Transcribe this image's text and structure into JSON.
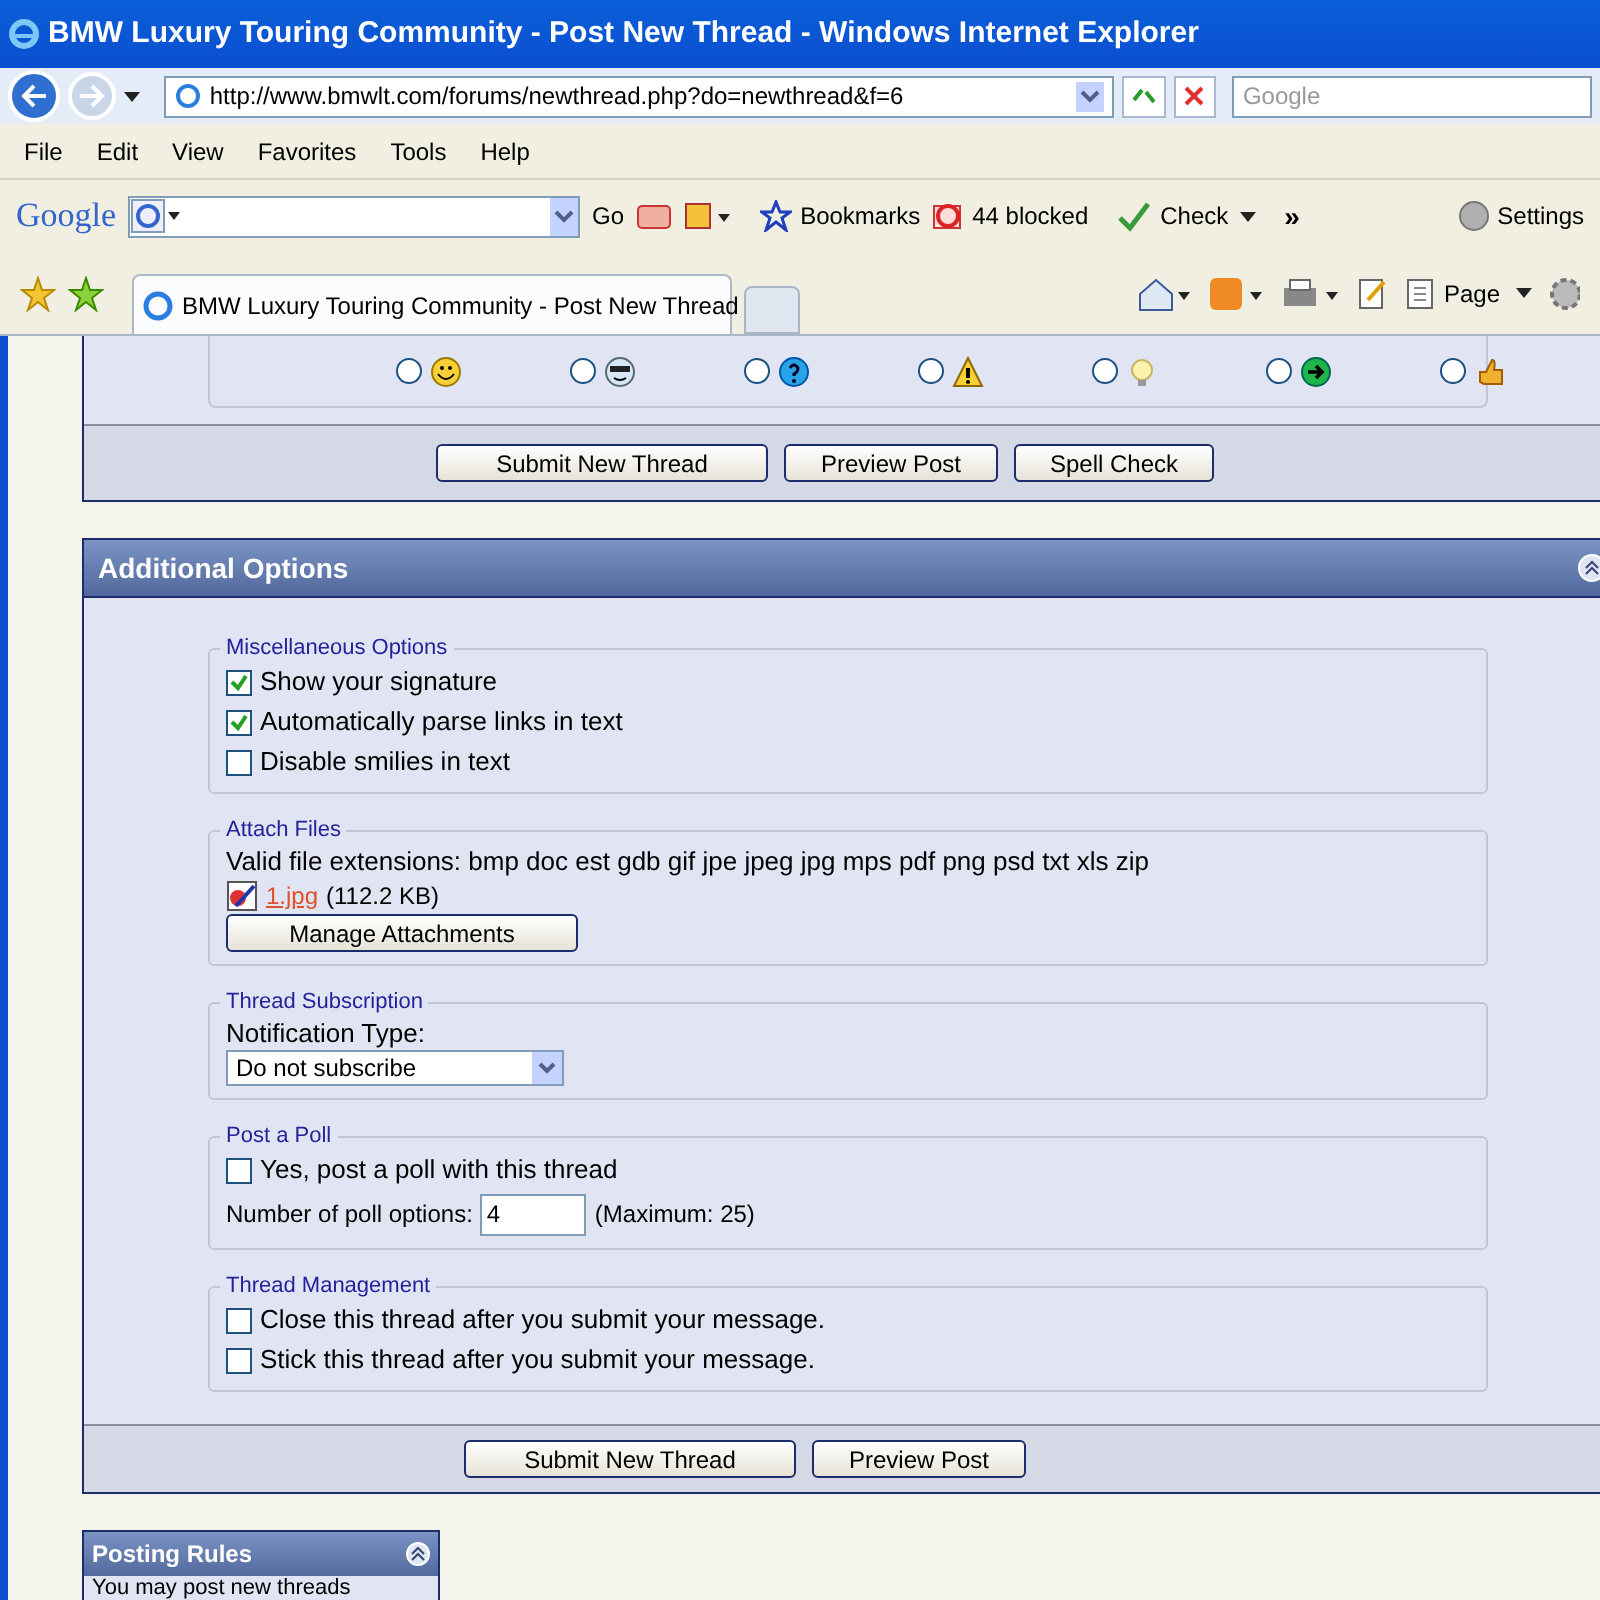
{
  "window": {
    "title": "BMW Luxury Touring Community - Post New Thread - Windows Internet Explorer"
  },
  "address_bar": {
    "url": "http://www.bmwlt.com/forums/newthread.php?do=newthread&f=6",
    "search_placeholder": "Google"
  },
  "menu": [
    "File",
    "Edit",
    "View",
    "Favorites",
    "Tools",
    "Help"
  ],
  "google_toolbar": {
    "logo": "Google",
    "go": "Go",
    "bookmarks": "Bookmarks",
    "blocked": "44 blocked",
    "check": "Check",
    "more": "»",
    "settings": "Settings"
  },
  "tabs": [
    {
      "label": "BMW Luxury Touring Community - Post New Thread",
      "selected": true
    }
  ],
  "command_bar": {
    "page": "Page"
  },
  "post_icons": [
    {
      "kind": "smile",
      "selected": false
    },
    {
      "kind": "cool",
      "selected": false
    },
    {
      "kind": "question",
      "selected": false
    },
    {
      "kind": "warning",
      "selected": false
    },
    {
      "kind": "idea",
      "selected": false
    },
    {
      "kind": "arrow",
      "selected": false
    },
    {
      "kind": "thumbs",
      "selected": false
    }
  ],
  "top_buttons": [
    "Submit New Thread",
    "Preview Post",
    "Spell Check"
  ],
  "additional_options": {
    "title": "Additional Options",
    "sections": [
      {
        "legend": "Miscellaneous Options",
        "items": [
          {
            "kind": "checkbox",
            "label": "Show your signature",
            "checked": true
          },
          {
            "kind": "checkbox",
            "label": "Automatically parse links in text",
            "checked": true
          },
          {
            "kind": "checkbox",
            "label": "Disable smilies in text",
            "checked": false
          }
        ]
      },
      {
        "legend": "Attach Files",
        "items": [
          {
            "kind": "text",
            "text": "Valid file extensions: bmp doc est gdb gif jpe jpeg jpg mps pdf png psd txt xls zip"
          },
          {
            "kind": "attachment",
            "file": "1.jpg",
            "size": "(112.2 KB)"
          },
          {
            "kind": "button",
            "label": "Manage Attachments"
          }
        ]
      },
      {
        "legend": "Thread Subscription",
        "items": [
          {
            "kind": "text",
            "text": "Notification Type:"
          },
          {
            "kind": "select",
            "value": "Do not subscribe"
          }
        ]
      },
      {
        "legend": "Post a Poll",
        "items": [
          {
            "kind": "checkbox",
            "label": "Yes, post a poll with this thread",
            "checked": false
          },
          {
            "kind": "number",
            "label": "Number of poll options:",
            "value": "4",
            "note": "(Maximum: 25)"
          }
        ]
      },
      {
        "legend": "Thread Management",
        "items": [
          {
            "kind": "checkbox",
            "label": "Close this thread after you submit your message.",
            "checked": false
          },
          {
            "kind": "checkbox",
            "label": "Stick this thread after you submit your message.",
            "checked": false
          }
        ]
      }
    ]
  },
  "bottom_buttons": [
    "Submit New Thread",
    "Preview Post"
  ],
  "posting_rules": {
    "title": "Posting Rules",
    "text": "You may post new threads"
  }
}
